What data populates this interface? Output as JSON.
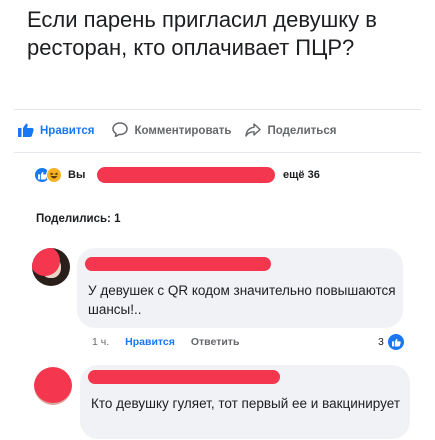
{
  "post": {
    "title": "Если парень пригласил девушку в ресторан, кто оплачивает ПЦР?"
  },
  "actions": {
    "like_label": "Нравится",
    "comment_label": "Комментировать",
    "share_label": "Поделиться"
  },
  "reactions": {
    "names_prefix": "Вы",
    "more_text": "ещё 36"
  },
  "shares": {
    "label": "Поделились: 1"
  },
  "comments": [
    {
      "text": "У девушек с QR кодом  значительно повышаются шансы!..",
      "time": "1 ч.",
      "like_label": "Нравится",
      "reply_label": "Ответить",
      "reaction_count": "3"
    },
    {
      "text": "Кто девушку гуляет, тот первый ее и вакцинирует"
    }
  ],
  "colors": {
    "accent": "#1877f2",
    "redaction": "#f4364f",
    "bubble": "#f0f2f5"
  }
}
